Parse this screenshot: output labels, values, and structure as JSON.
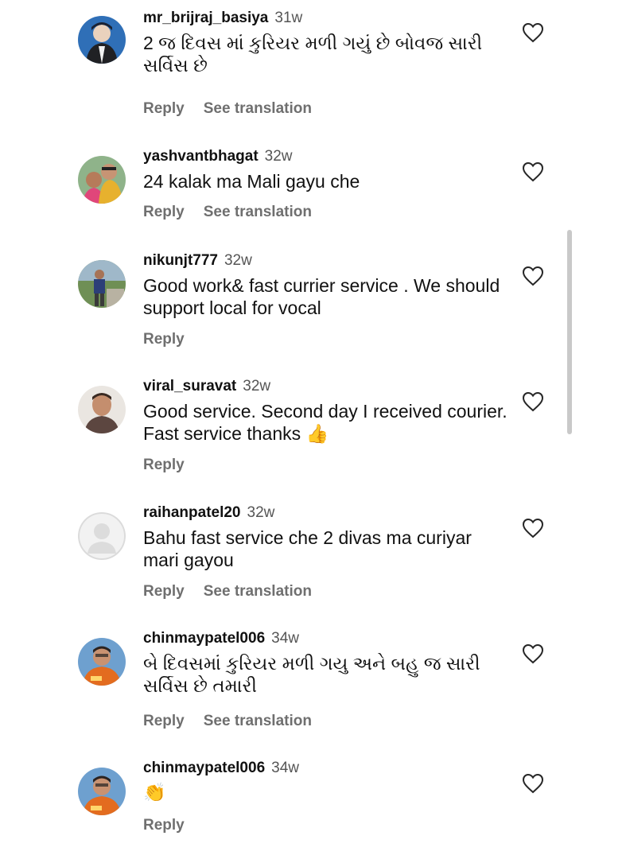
{
  "comments": [
    {
      "username": "mr_brijraj_basiya",
      "age": "31w",
      "text": "2 જ દિવસ માં કુરિયર મળી ગયું છે બોવજ સારી સર્વિસ છે",
      "reply": "Reply",
      "translate": "See translation"
    },
    {
      "username": "yashvantbhagat",
      "age": "32w",
      "text": "24 kalak ma Mali gayu che",
      "reply": "Reply",
      "translate": "See translation"
    },
    {
      "username": "nikunjt777",
      "age": "32w",
      "text": "Good work& fast currier service . We should support local for vocal",
      "reply": "Reply"
    },
    {
      "username": "viral_suravat",
      "age": "32w",
      "text": "Good service.  Second day I received courier.  Fast service thanks 👍",
      "reply": "Reply"
    },
    {
      "username": "raihanpatel20",
      "age": "32w",
      "text": "Bahu  fast service che  2 divas ma  curiyar mari gayou",
      "reply": "Reply",
      "translate": "See translation"
    },
    {
      "username": "chinmaypatel006",
      "age": "34w",
      "text": "બે દિવસમાં કુરિયર મળી ગયુ અને બહુ જ સારી સર્વિસ છે તમારી",
      "reply": "Reply",
      "translate": "See translation"
    },
    {
      "username": "chinmaypatel006",
      "age": "34w",
      "text": "👏",
      "reply": "Reply"
    }
  ],
  "icons": {
    "like": "heart-outline-icon"
  },
  "colors": {
    "text": "#111111",
    "muted": "#6f6f6f",
    "icon": "#262626"
  }
}
